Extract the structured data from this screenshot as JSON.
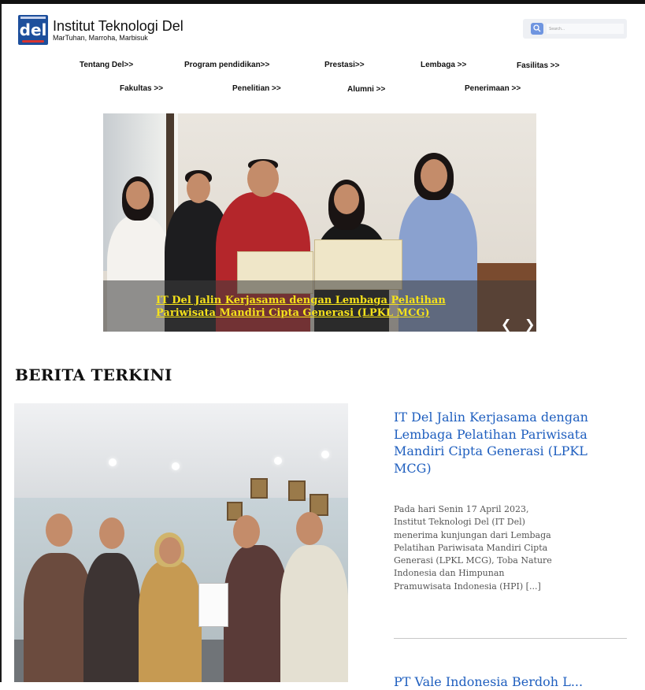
{
  "header": {
    "logo_mark": "del",
    "site_title": "Institut Teknologi Del",
    "tagline": "MarTuhan, Marroha, Marbisuk"
  },
  "search": {
    "placeholder": "Search..."
  },
  "nav": {
    "row1": [
      "Tentang Del>>",
      "Program pendidikan>>",
      "Prestasi>>",
      "Lembaga >>",
      "Fasilitas >>"
    ],
    "row2": [
      "Fakultas >>",
      "Penelitian >>",
      "Alumni >>",
      "Penerimaan >>"
    ]
  },
  "hero": {
    "caption": "IT Del Jalin Kerjasama dengan Lembaga Pelatihan Pariwisata Mandiri Cipta Generasi (LPKL MCG)",
    "prev_icon": "chevron-left-icon",
    "next_icon": "chevron-right-icon"
  },
  "news": {
    "section_title": "BERITA TERKINI",
    "article_title": "IT Del Jalin Kerjasama dengan Lembaga Pelatihan Pariwisata Mandiri Cipta Generasi (LPKL MCG)",
    "article_excerpt": "Pada hari Senin 17 April 2023, Institut Teknologi Del (IT Del) menerima kunjungan dari Lembaga Pelatihan Pariwisata Mandiri Cipta Generasi (LPKL MCG), Toba Nature Indonesia dan Himpunan Pramuwisata Indonesia (HPI) [...]",
    "next_title": "PT Vale Indonesia Berdoh L..."
  },
  "colors": {
    "brand_blue": "#1d4f9c",
    "link_blue": "#1f5fbf",
    "caption_yellow": "#f5e21b"
  }
}
